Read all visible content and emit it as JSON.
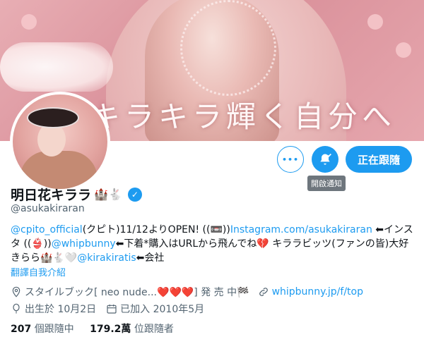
{
  "banner": {
    "overlay_text": "キラキラ輝く自分へ"
  },
  "actions": {
    "more_label": "•••",
    "notify_tooltip": "開啟通知",
    "follow_label": "正在跟隨"
  },
  "profile": {
    "display_name": "明日花キララ",
    "name_emojis": "🏰🐇",
    "verified_mark": "✓",
    "handle": "@asukakiraran"
  },
  "bio": {
    "mention_cpito": "@cpito_official",
    "text_1": "(クピト)11/12よりOPEN! ((📼))",
    "link_instagram": "Instagram.com/asukakiraran",
    "text_2": " ⬅インスタ ((👙))",
    "mention_whipbunny": "@whipbunny",
    "text_3": "⬅下着*購入はURLから飛んでね💔 キララビッツ(ファンの皆)大好きらら🏰🐇🤍",
    "mention_kirakiratis": "@kirakiratis",
    "text_4": "⬅会社"
  },
  "translate_label": "翻譯自我介紹",
  "meta": {
    "location": "スタイルブック[ neo nude...❤️❤️❤️] 発 売 中🏁",
    "website": "whipbunny.jp/f/top",
    "birthday": "出生於 10月2日",
    "joined": "已加入 2010年5月"
  },
  "stats": {
    "following_count": "207",
    "following_label": "個跟隨中",
    "followers_count": "179.2萬",
    "followers_label": "位跟隨者"
  },
  "colors": {
    "accent": "#1d9bf0",
    "text_primary": "#0f1419",
    "text_secondary": "#536471"
  }
}
